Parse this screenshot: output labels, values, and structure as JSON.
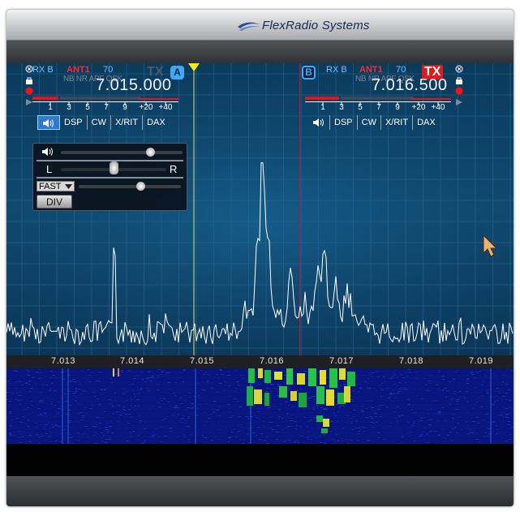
{
  "window": {
    "title": "FlexRadio Systems"
  },
  "frequency_scale": {
    "labels": [
      "7.013",
      "7.014",
      "7.015",
      "7.016",
      "7.017",
      "7.018",
      "7.019"
    ]
  },
  "slice_a": {
    "rx_label": "RX B",
    "antenna": "ANT1",
    "filter": "70",
    "tx_label": "TX",
    "badge": "A",
    "modes": "NB NR APF QSK",
    "frequency": "7.015.000",
    "smeter_scale": [
      "1",
      "3",
      "5",
      "7",
      "9",
      "+20",
      "+40"
    ],
    "tabs": [
      "DSP",
      "CW",
      "X/RIT",
      "DAX"
    ],
    "speaker_icon": "speaker-icon"
  },
  "slice_b": {
    "rx_label": "RX B",
    "antenna": "ANT1",
    "filter": "70",
    "tx_label": "TX",
    "badge": "B",
    "modes": "NB NR APF QSK",
    "frequency": "7.016.500",
    "smeter_scale": [
      "1",
      "3",
      "5",
      "7",
      "9",
      "+20",
      "+40"
    ],
    "tabs": [
      "DSP",
      "CW",
      "X/RIT",
      "DAX"
    ],
    "speaker_icon": "speaker-icon"
  },
  "audio_panel": {
    "left_label": "L",
    "right_label": "R",
    "agc_mode": "FAST",
    "div_label": "DIV",
    "volume": 0.73,
    "pan": 0.5,
    "agc_threshold": 0.6
  },
  "colors": {
    "pan_bg": "#0d4369",
    "grid": "#2a6a94",
    "trace": "#ffffff",
    "slice_a_line": "#d8e26a",
    "slice_b_line": "#c0142a",
    "tx_red": "#e0191c",
    "accent_blue": "#3fa9f5"
  }
}
